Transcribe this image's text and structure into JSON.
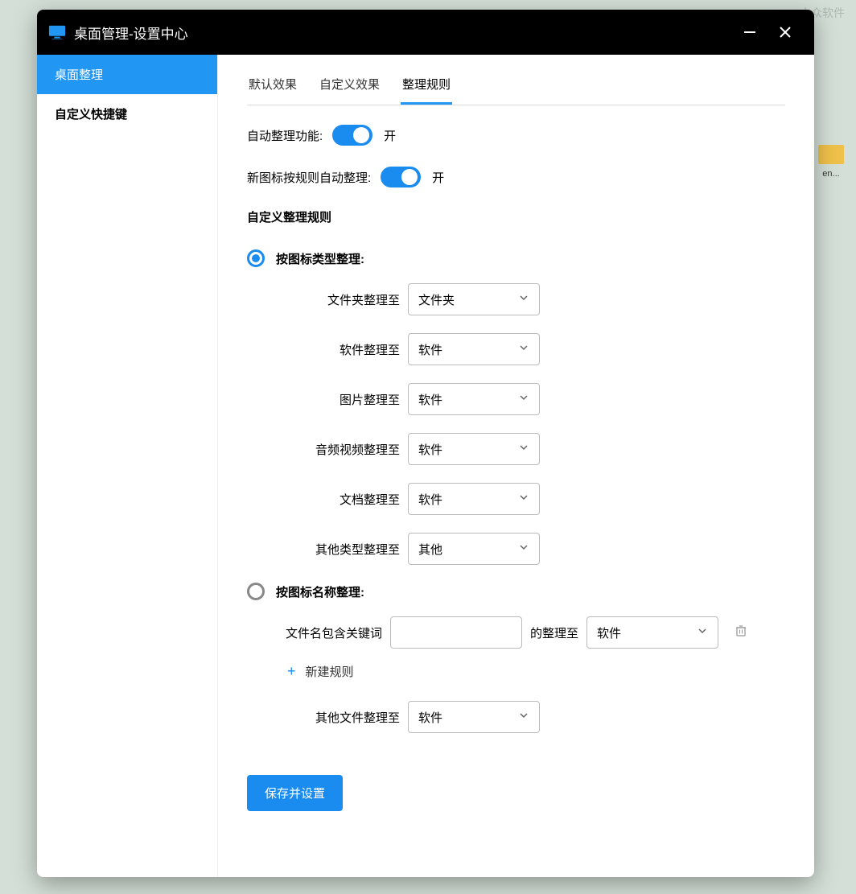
{
  "watermark": "小众软件",
  "desktop_folder_hint": "en...",
  "titlebar": {
    "title": "桌面管理-设置中心"
  },
  "sidebar": {
    "items": [
      {
        "label": "桌面整理",
        "active": true
      },
      {
        "label": "自定义快捷键",
        "active": false
      }
    ]
  },
  "tabs": [
    {
      "label": "默认效果",
      "active": false
    },
    {
      "label": "自定义效果",
      "active": false
    },
    {
      "label": "整理规则",
      "active": true
    }
  ],
  "toggles": {
    "auto_sort": {
      "label": "自动整理功能:",
      "on": true,
      "status": "开"
    },
    "new_icon_sort": {
      "label": "新图标按规则自动整理:",
      "on": true,
      "status": "开"
    }
  },
  "section_title": "自定义整理规则",
  "radio_type": {
    "label": "按图标类型整理:",
    "selected": true
  },
  "type_rules": [
    {
      "label": "文件夹整理至",
      "value": "文件夹"
    },
    {
      "label": "软件整理至",
      "value": "软件"
    },
    {
      "label": "图片整理至",
      "value": "软件"
    },
    {
      "label": "音频视频整理至",
      "value": "软件"
    },
    {
      "label": "文档整理至",
      "value": "软件"
    },
    {
      "label": "其他类型整理至",
      "value": "其他"
    }
  ],
  "radio_name": {
    "label": "按图标名称整理:",
    "selected": false
  },
  "name_rule": {
    "prefix": "文件名包含关键词",
    "keyword": "",
    "mid": "的整理至",
    "value": "软件"
  },
  "add_rule_label": "新建规则",
  "other_file_rule": {
    "label": "其他文件整理至",
    "value": "软件"
  },
  "save_button": "保存并设置"
}
